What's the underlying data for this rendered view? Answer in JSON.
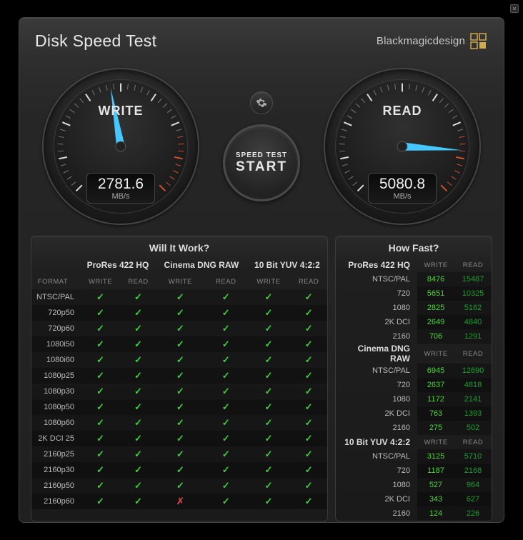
{
  "title": "Disk Speed Test",
  "brand": "Blackmagicdesign",
  "gauges": {
    "write": {
      "label": "WRITE",
      "value": "2781.6",
      "unit": "MB/s",
      "angle": -68
    },
    "read": {
      "label": "READ",
      "value": "5080.8",
      "unit": "MB/s",
      "angle": 8
    }
  },
  "startBtn": {
    "line1": "SPEED TEST",
    "line2": "START"
  },
  "willItWork": {
    "title": "Will It Work?",
    "formatLabel": "FORMAT",
    "groups": [
      "ProRes 422 HQ",
      "Cinema DNG RAW",
      "10 Bit YUV 4:2:2"
    ],
    "sub": [
      "WRITE",
      "READ",
      "WRITE",
      "READ",
      "WRITE",
      "READ"
    ],
    "rows": [
      {
        "f": "NTSC/PAL",
        "v": [
          1,
          1,
          1,
          1,
          1,
          1
        ]
      },
      {
        "f": "720p50",
        "v": [
          1,
          1,
          1,
          1,
          1,
          1
        ]
      },
      {
        "f": "720p60",
        "v": [
          1,
          1,
          1,
          1,
          1,
          1
        ]
      },
      {
        "f": "1080i50",
        "v": [
          1,
          1,
          1,
          1,
          1,
          1
        ]
      },
      {
        "f": "1080i60",
        "v": [
          1,
          1,
          1,
          1,
          1,
          1
        ]
      },
      {
        "f": "1080p25",
        "v": [
          1,
          1,
          1,
          1,
          1,
          1
        ]
      },
      {
        "f": "1080p30",
        "v": [
          1,
          1,
          1,
          1,
          1,
          1
        ]
      },
      {
        "f": "1080p50",
        "v": [
          1,
          1,
          1,
          1,
          1,
          1
        ]
      },
      {
        "f": "1080p60",
        "v": [
          1,
          1,
          1,
          1,
          1,
          1
        ]
      },
      {
        "f": "2K DCI 25",
        "v": [
          1,
          1,
          1,
          1,
          1,
          1
        ]
      },
      {
        "f": "2160p25",
        "v": [
          1,
          1,
          1,
          1,
          1,
          1
        ]
      },
      {
        "f": "2160p30",
        "v": [
          1,
          1,
          1,
          1,
          1,
          1
        ]
      },
      {
        "f": "2160p50",
        "v": [
          1,
          1,
          1,
          1,
          1,
          1
        ]
      },
      {
        "f": "2160p60",
        "v": [
          1,
          1,
          0,
          1,
          1,
          1
        ]
      }
    ]
  },
  "howFast": {
    "title": "How Fast?",
    "sub": [
      "WRITE",
      "READ"
    ],
    "sections": [
      {
        "name": "ProRes 422 HQ",
        "rows": [
          {
            "f": "NTSC/PAL",
            "w": "8476",
            "r": "15487"
          },
          {
            "f": "720",
            "w": "5651",
            "r": "10325"
          },
          {
            "f": "1080",
            "w": "2825",
            "r": "5162"
          },
          {
            "f": "2K DCI",
            "w": "2649",
            "r": "4840"
          },
          {
            "f": "2160",
            "w": "706",
            "r": "1291"
          }
        ]
      },
      {
        "name": "Cinema DNG RAW",
        "rows": [
          {
            "f": "NTSC/PAL",
            "w": "6945",
            "r": "12690"
          },
          {
            "f": "720",
            "w": "2637",
            "r": "4818"
          },
          {
            "f": "1080",
            "w": "1172",
            "r": "2141"
          },
          {
            "f": "2K DCI",
            "w": "763",
            "r": "1393"
          },
          {
            "f": "2160",
            "w": "275",
            "r": "502"
          }
        ]
      },
      {
        "name": "10 Bit YUV 4:2:2",
        "rows": [
          {
            "f": "NTSC/PAL",
            "w": "3125",
            "r": "5710"
          },
          {
            "f": "720",
            "w": "1187",
            "r": "2168"
          },
          {
            "f": "1080",
            "w": "527",
            "r": "964"
          },
          {
            "f": "2K DCI",
            "w": "343",
            "r": "627"
          },
          {
            "f": "2160",
            "w": "124",
            "r": "226"
          }
        ]
      }
    ]
  }
}
